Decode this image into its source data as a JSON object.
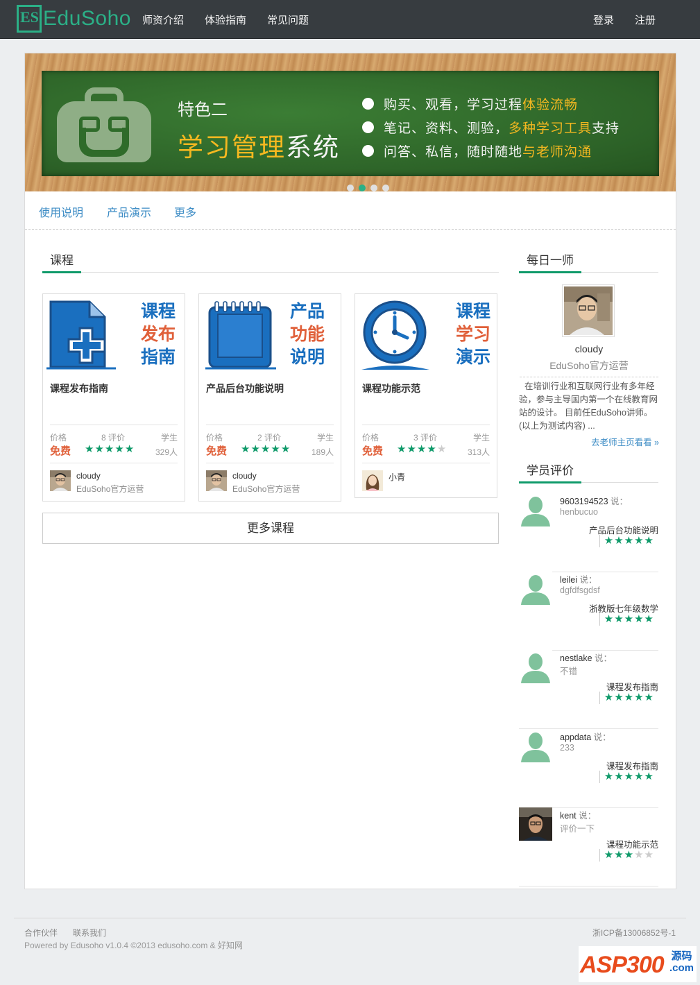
{
  "brand": {
    "logo_text": "EduSoho",
    "logo_mark": "ES",
    "accent": "#2bb087"
  },
  "nav": {
    "items": [
      {
        "label": "师资介绍"
      },
      {
        "label": "体验指南"
      },
      {
        "label": "常见问题"
      }
    ],
    "login": "登录",
    "register": "注册"
  },
  "banner": {
    "subtitle": "特色二",
    "title_part1": "学习管理",
    "title_part2": "系统",
    "points": [
      {
        "text": "购买、观看，学习过程",
        "highlight": "体验流畅",
        "after": ""
      },
      {
        "text": "笔记、资料、测验，",
        "highlight": "多种学习工具",
        "after": "支持"
      },
      {
        "text": "问答、私信，随时随地",
        "highlight": "与老师沟通",
        "after": ""
      }
    ],
    "slides": 4,
    "active_slide": 2
  },
  "subnav": {
    "items": [
      {
        "label": "使用说明"
      },
      {
        "label": "产品演示"
      },
      {
        "label": "更多"
      }
    ]
  },
  "courses_section": {
    "heading": "课程",
    "labels": {
      "price": "价格",
      "reviews_suffix": "评价",
      "students": "学生"
    },
    "courses": [
      {
        "thumb_words": [
          "课程",
          "发布",
          "指南"
        ],
        "title": "课程发布指南",
        "price": "免费",
        "review_count": "8",
        "rating": 5,
        "students": "329人",
        "teacher": "cloudy",
        "teacher_title": "EduSoho官方运营"
      },
      {
        "thumb_words": [
          "产品",
          "功能",
          "说明"
        ],
        "title": "产品后台功能说明",
        "price": "免费",
        "review_count": "2",
        "rating": 5,
        "students": "189人",
        "teacher": "cloudy",
        "teacher_title": "EduSoho官方运营"
      },
      {
        "thumb_words": [
          "课程",
          "学习",
          "演示"
        ],
        "title": "课程功能示范",
        "price": "免费",
        "review_count": "3",
        "rating": 4,
        "students": "313人",
        "teacher": "小青",
        "teacher_title": ""
      }
    ],
    "more_button": "更多课程"
  },
  "daily_teacher": {
    "heading": "每日一师",
    "name": "cloudy",
    "title": "EduSoho官方运营",
    "bio": "在培训行业和互联网行业有多年经验，参与主导国内第一个在线教育网站的设计。 目前任EduSoho讲师。 (以上为测试内容) ...",
    "link": "去老师主页看看 »"
  },
  "reviews_section": {
    "heading": "学员评价",
    "says": "说：",
    "reviews": [
      {
        "user": "9603194523",
        "text": "henbucuo",
        "course": "产品后台功能说明",
        "rating": 5
      },
      {
        "user": "leilei",
        "text": "dgfdfsgdsf",
        "course": "浙教版七年级数学",
        "rating": 5
      },
      {
        "user": "nestlake",
        "text": "不错",
        "course": "课程发布指南",
        "rating": 5
      },
      {
        "user": "appdata",
        "text": "233",
        "course": "课程发布指南",
        "rating": 5
      },
      {
        "user": "kent",
        "text": "评价一下",
        "course": "课程功能示范",
        "rating": 3
      }
    ]
  },
  "footer": {
    "links": [
      {
        "label": "合作伙伴"
      },
      {
        "label": "联系我们"
      }
    ],
    "powered": "Powered by Edusoho v1.0.4 ©2013 edusoho.com & 好知网",
    "icp": "浙ICP备13006852号-1"
  },
  "watermark": {
    "main": "ASP300",
    "side_top": "源码",
    "side_bottom": ".com"
  }
}
